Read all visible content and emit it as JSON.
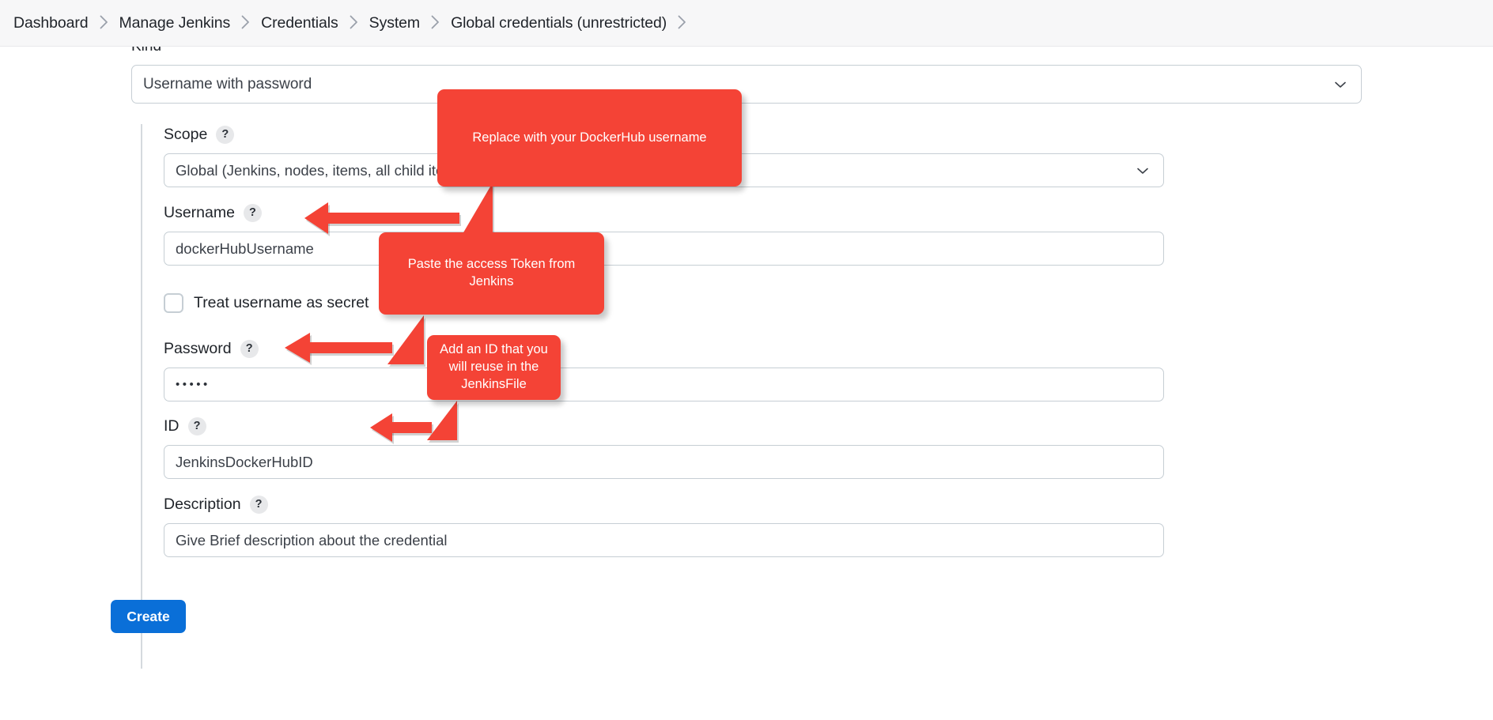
{
  "breadcrumb": {
    "items": [
      {
        "label": "Dashboard"
      },
      {
        "label": "Manage Jenkins"
      },
      {
        "label": "Credentials"
      },
      {
        "label": "System"
      },
      {
        "label": "Global credentials (unrestricted)"
      }
    ],
    "separator_icon": "chevron-right-icon"
  },
  "form": {
    "kind": {
      "label": "Kind",
      "value": "Username with password",
      "chevron_icon": "chevron-down-icon"
    },
    "scope": {
      "label": "Scope",
      "help": "?",
      "value": "Global (Jenkins, nodes, items, all child items, etc)",
      "chevron_icon": "chevron-down-icon"
    },
    "username": {
      "label": "Username",
      "help": "?",
      "value": "dockerHubUsername"
    },
    "treat_username_as_secret": {
      "label": "Treat username as secret",
      "help": "?",
      "checked": false
    },
    "password": {
      "label": "Password",
      "help": "?",
      "value": "•••••"
    },
    "id": {
      "label": "ID",
      "help": "?",
      "value": "JenkinsDockerHubID"
    },
    "description": {
      "label": "Description",
      "help": "?",
      "value": "Give Brief description about the credential"
    },
    "submit": {
      "label": "Create"
    }
  },
  "annotations": [
    {
      "text": "Replace with your DockerHub username"
    },
    {
      "text": "Paste the access Token from Jenkins"
    },
    {
      "text": "Add an ID that you will reuse in the JenkinsFile"
    }
  ],
  "colors": {
    "annotation_red": "#f44336",
    "primary_blue": "#0a6fd8",
    "breadcrumb_bg": "#f7f7f8",
    "input_border": "#c6ced4"
  }
}
